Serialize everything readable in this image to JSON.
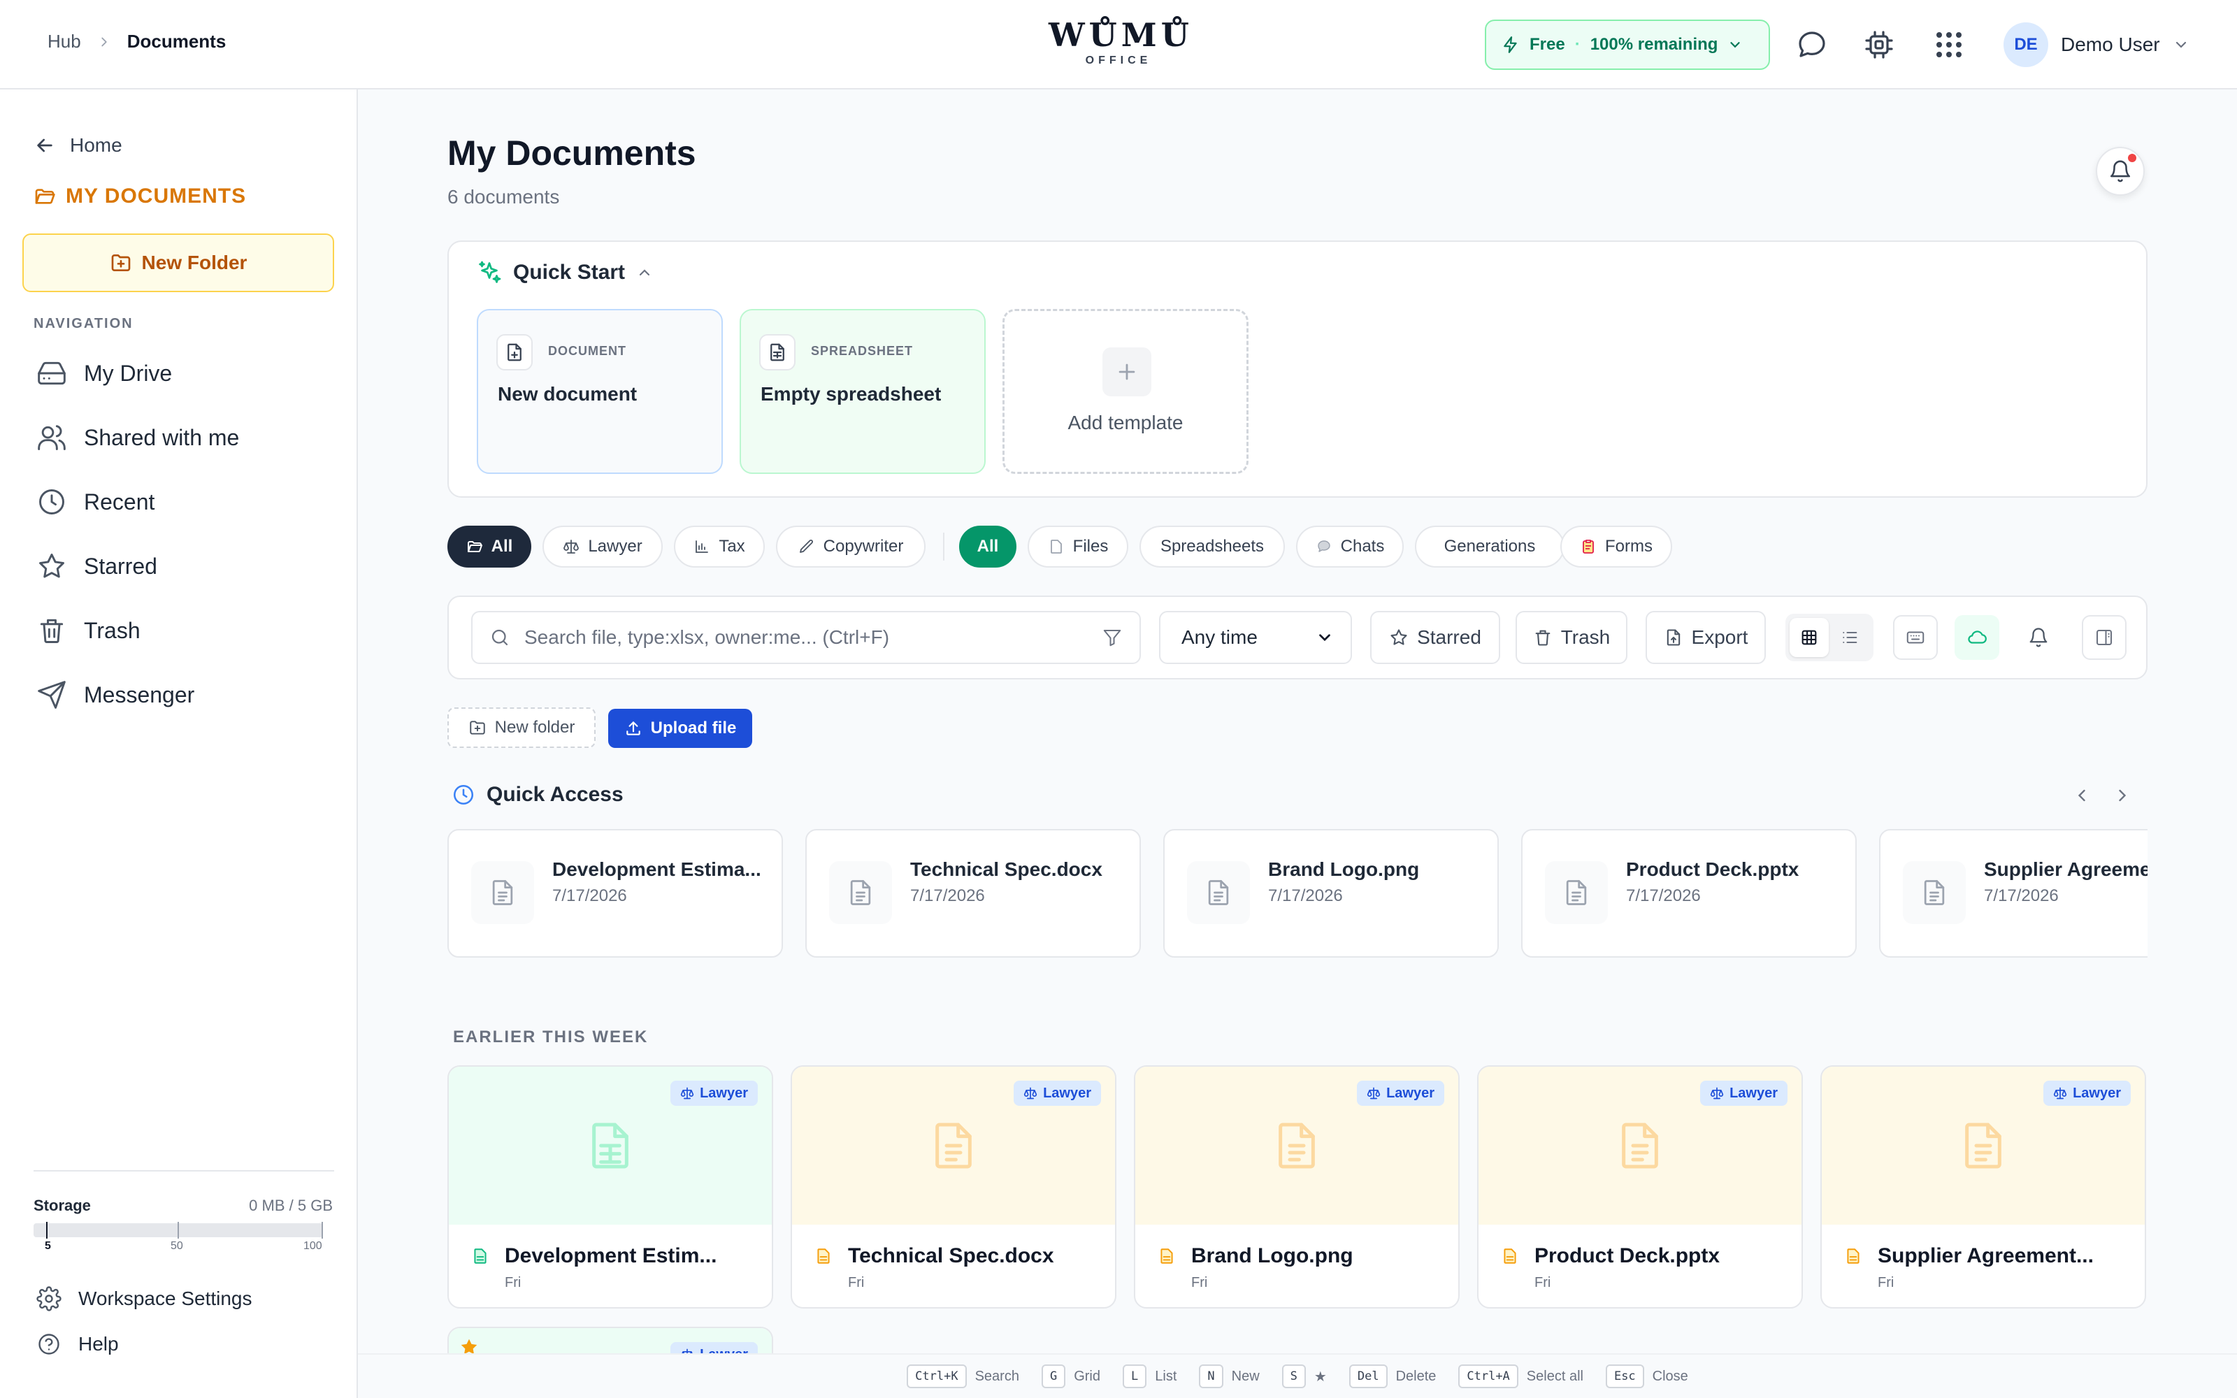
{
  "header": {
    "breadcrumb": {
      "hub": "Hub",
      "current": "Documents"
    },
    "logo": {
      "main": "WŮMŮ",
      "sub": "OFFICE"
    },
    "plan": {
      "name": "Free",
      "separator": "·",
      "remaining": "100% remaining"
    },
    "user": {
      "initials": "DE",
      "name": "Demo User"
    }
  },
  "sidebar": {
    "home": "Home",
    "section_title": "MY DOCUMENTS",
    "new_folder": "New Folder",
    "nav_heading": "NAVIGATION",
    "items": [
      {
        "label": "My Drive",
        "icon": "hard-drive-icon"
      },
      {
        "label": "Shared with me",
        "icon": "users-icon"
      },
      {
        "label": "Recent",
        "icon": "clock-icon"
      },
      {
        "label": "Starred",
        "icon": "star-icon"
      },
      {
        "label": "Trash",
        "icon": "trash-icon"
      },
      {
        "label": "Messenger",
        "icon": "send-icon"
      }
    ],
    "storage": {
      "label": "Storage",
      "value": "0 MB / 5 GB",
      "used_fraction": 0.0,
      "scale": [
        "5",
        "50",
        "100"
      ]
    },
    "workspace_settings": "Workspace Settings",
    "help": "Help"
  },
  "main": {
    "title": "My Documents",
    "subtitle": "6 documents",
    "quick_start": {
      "title": "Quick Start",
      "cards": [
        {
          "type": "DOCUMENT",
          "label": "New document"
        },
        {
          "type": "SPREADSHEET",
          "label": "Empty spreadsheet"
        }
      ],
      "add_template": "Add template"
    },
    "filters_role": [
      "All",
      "Lawyer",
      "Tax",
      "Copywriter"
    ],
    "filters_type": [
      "All",
      "Files",
      "Spreadsheets",
      "Chats",
      "Generations",
      "Forms"
    ],
    "toolbar": {
      "search_placeholder": "Search file, type:xlsx, owner:me... (Ctrl+F)",
      "time_filter": "Any time",
      "starred": "Starred",
      "trash": "Trash",
      "export": "Export"
    },
    "actions": {
      "new_folder": "New folder",
      "upload": "Upload file"
    },
    "quick_access": {
      "title": "Quick Access",
      "items": [
        {
          "name": "Development Estima...",
          "date": "7/17/2026"
        },
        {
          "name": "Technical Spec.docx",
          "date": "7/17/2026"
        },
        {
          "name": "Brand Logo.png",
          "date": "7/17/2026"
        },
        {
          "name": "Product Deck.pptx",
          "date": "7/17/2026"
        },
        {
          "name": "Supplier Agreeme",
          "date": "7/17/2026"
        }
      ]
    },
    "earlier_section": {
      "title": "EARLIER THIS WEEK",
      "items": [
        {
          "name": "Development Estim...",
          "when": "Fri",
          "badge": "Lawyer",
          "kind": "spreadsheet"
        },
        {
          "name": "Technical Spec.docx",
          "when": "Fri",
          "badge": "Lawyer",
          "kind": "document"
        },
        {
          "name": "Brand Logo.png",
          "when": "Fri",
          "badge": "Lawyer",
          "kind": "document"
        },
        {
          "name": "Product Deck.pptx",
          "when": "Fri",
          "badge": "Lawyer",
          "kind": "document"
        },
        {
          "name": "Supplier Agreement...",
          "when": "Fri",
          "badge": "Lawyer",
          "kind": "document"
        }
      ],
      "partial_badge": "Lawyer"
    }
  },
  "shortcuts": [
    {
      "key": "Ctrl+K",
      "label": "Search"
    },
    {
      "key": "G",
      "label": "Grid"
    },
    {
      "key": "L",
      "label": "List"
    },
    {
      "key": "N",
      "label": "New"
    },
    {
      "key": "S",
      "label": "★"
    },
    {
      "key": "Del",
      "label": "Delete"
    },
    {
      "key": "Ctrl+A",
      "label": "Select all"
    },
    {
      "key": "Esc",
      "label": "Close"
    }
  ],
  "colors": {
    "accent_green": "#059669",
    "accent_blue": "#1d4ed8",
    "section_amber": "#d97706",
    "badge_bg": "#dbeafe",
    "spreadsheet_thumb": "#ecfdf5",
    "document_thumb": "#fef9e7"
  }
}
